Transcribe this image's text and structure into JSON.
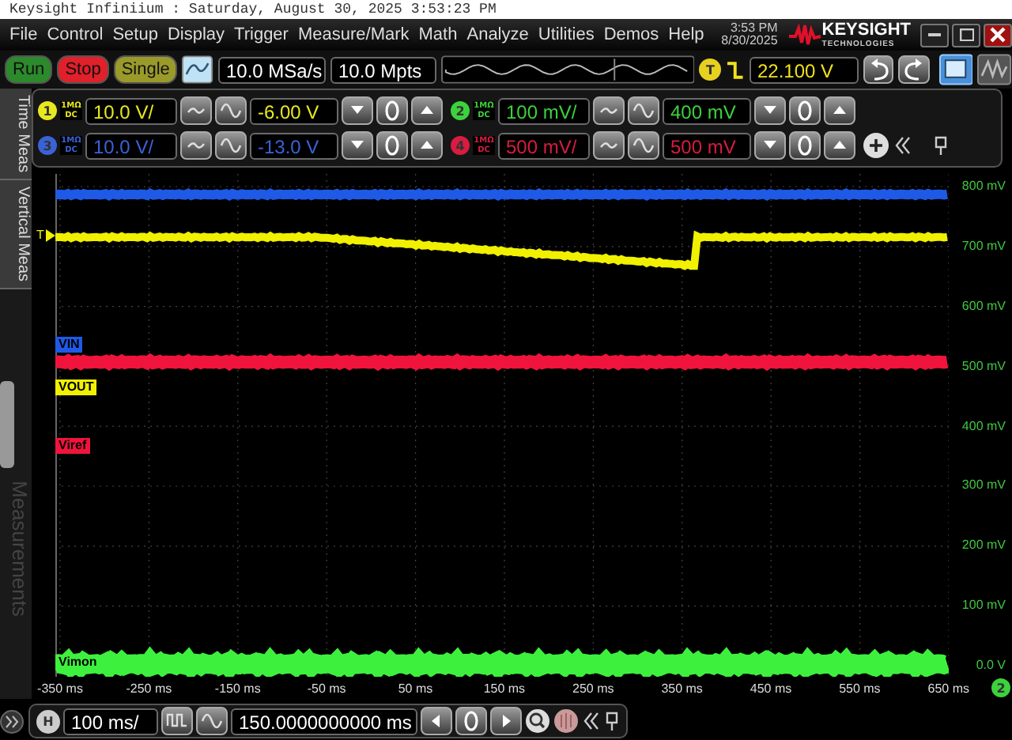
{
  "title_bar": {
    "text": "Keysight Infiniium : Saturday, August 30, 2025 3:53:23 PM"
  },
  "menu": [
    "File",
    "Control",
    "Setup",
    "Display",
    "Trigger",
    "Measure/Mark",
    "Math",
    "Analyze",
    "Utilities",
    "Demos",
    "Help"
  ],
  "clock": {
    "time": "3:53 PM",
    "date": "8/30/2025"
  },
  "brand": {
    "name": "KEYSIGHT",
    "tagline": "TECHNOLOGIES"
  },
  "acquisition": {
    "buttons": [
      {
        "label": "Run",
        "color": "#2c8a2c"
      },
      {
        "label": "Stop",
        "color": "#e0202a"
      },
      {
        "label": "Single",
        "color": "#9a9a2a"
      }
    ],
    "sample_rate": "10.0 MSa/s",
    "memory_depth": "10.0 Mpts"
  },
  "trigger": {
    "badge": "T",
    "level": "22.100 V",
    "marker": "T"
  },
  "channels": [
    {
      "number": "1",
      "impedance": "1MΩ",
      "coupling": "DC",
      "scale": "10.0 V/",
      "offset": "-6.00 V",
      "color": "#e8e820"
    },
    {
      "number": "2",
      "impedance": "1MΩ",
      "coupling": "DC",
      "scale": "100 mV/",
      "offset": "400 mV",
      "color": "#3cd23c"
    },
    {
      "number": "3",
      "impedance": "1MΩ",
      "coupling": "DC",
      "scale": "10.0 V/",
      "offset": "-13.0 V",
      "color": "#3a62d8"
    },
    {
      "number": "4",
      "impedance": "1MΩ",
      "coupling": "DC",
      "scale": "500 mV/",
      "offset": "500 mV",
      "color": "#d81c40"
    }
  ],
  "side_tabs": [
    {
      "label": "Time Meas",
      "disabled": false
    },
    {
      "label": "Vertical Meas",
      "disabled": false
    },
    {
      "label": "Measurements",
      "disabled": true
    }
  ],
  "waveform_labels": [
    {
      "text": "VIN",
      "color": "#1f5ae6"
    },
    {
      "text": "VOUT",
      "color": "#f0f000"
    },
    {
      "text": "Viref",
      "color": "#f0143c"
    },
    {
      "text": "Vimon",
      "color": "#3ef03e"
    }
  ],
  "y_axis": [
    "800 mV",
    "700 mV",
    "600 mV",
    "500 mV",
    "400 mV",
    "300 mV",
    "200 mV",
    "100 mV",
    "0.0 V"
  ],
  "x_axis": [
    "-350 ms",
    "-250 ms",
    "-150 ms",
    "-50 ms",
    "50 ms",
    "150 ms",
    "250 ms",
    "350 ms",
    "450 ms",
    "550 ms",
    "650 ms"
  ],
  "axis_channel": "2",
  "horizontal": {
    "badge": "H",
    "scale": "100 ms/",
    "position": "150.0000000000 ms"
  }
}
